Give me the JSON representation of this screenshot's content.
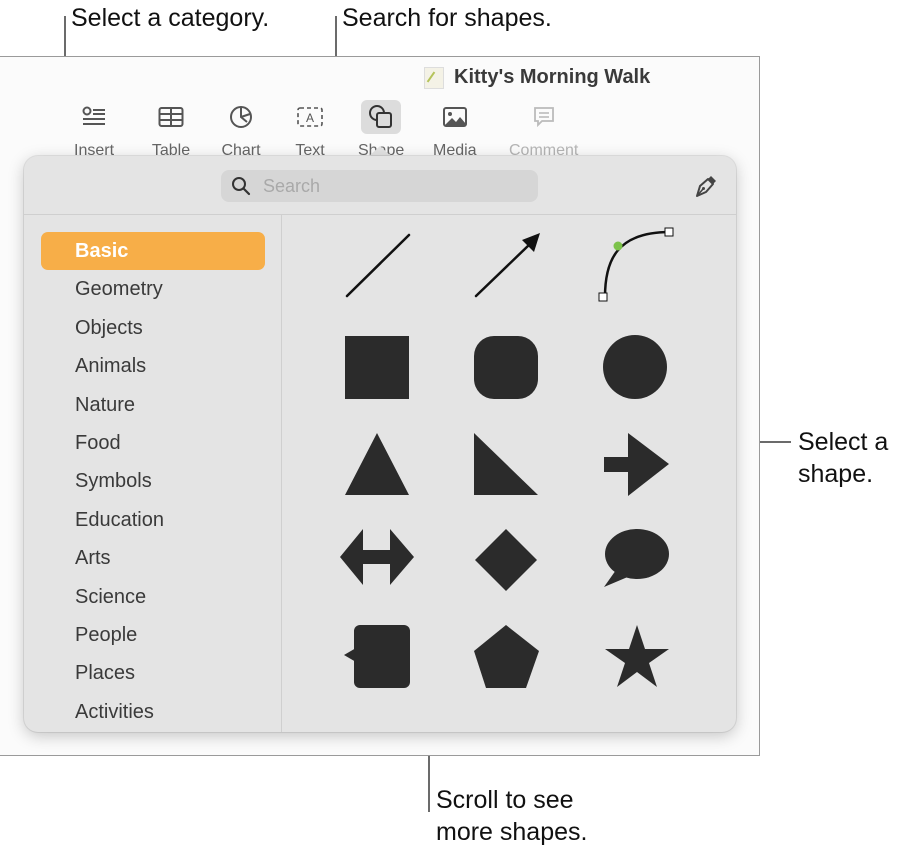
{
  "callouts": {
    "select_category": "Select a category.",
    "search_shapes": "Search for shapes.",
    "select_shape_line1": "Select a",
    "select_shape_line2": "shape.",
    "scroll_line1": "Scroll to see",
    "scroll_line2": "more shapes."
  },
  "document": {
    "title": "Kitty's Morning Walk",
    "icon": "pages-document-icon"
  },
  "toolbar": {
    "items": [
      {
        "label": "Insert",
        "icon": "insert-icon",
        "state": "normal"
      },
      {
        "label": "Table",
        "icon": "table-icon",
        "state": "normal"
      },
      {
        "label": "Chart",
        "icon": "chart-icon",
        "state": "normal"
      },
      {
        "label": "Text",
        "icon": "text-box-icon",
        "state": "normal"
      },
      {
        "label": "Shape",
        "icon": "shape-icon",
        "state": "active"
      },
      {
        "label": "Media",
        "icon": "media-icon",
        "state": "normal"
      },
      {
        "label": "Comment",
        "icon": "comment-icon",
        "state": "disabled"
      }
    ]
  },
  "shape_popover": {
    "search": {
      "placeholder": "Search",
      "value": ""
    },
    "draw_pen_icon": "pen-icon",
    "accent_color": "#f7ae48",
    "selected_category": "Basic",
    "categories": [
      "Basic",
      "Geometry",
      "Objects",
      "Animals",
      "Nature",
      "Food",
      "Symbols",
      "Education",
      "Arts",
      "Science",
      "People",
      "Places",
      "Activities"
    ],
    "shapes": [
      "line",
      "arrow-line",
      "curve",
      "square",
      "rounded-square",
      "circle",
      "triangle",
      "right-triangle",
      "arrow-right",
      "double-arrow",
      "diamond",
      "speech-bubble",
      "callout-square",
      "pentagon",
      "star"
    ]
  }
}
